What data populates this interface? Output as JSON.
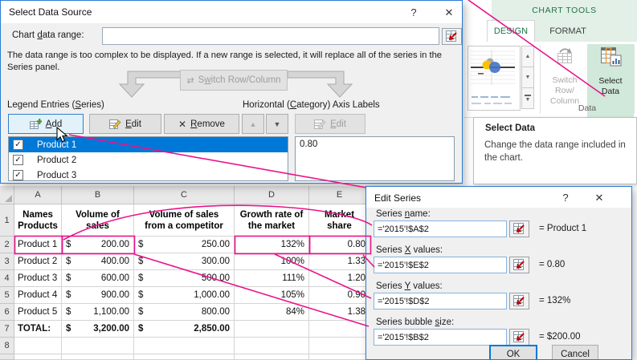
{
  "colors": {
    "excel_green": "#217346",
    "selection_blue": "#0078d7",
    "annotation_pink": "#e9138a",
    "contextual_tab_bg": "#e2f0e7",
    "active_button_bg": "#d0e9da"
  },
  "select_data_source": {
    "title": "Select Data Source",
    "help_icon": "?",
    "close_icon": "✕",
    "chart_data_range_label": {
      "text": "Chart data range:",
      "accel": 6
    },
    "chart_data_range_value": "",
    "warning_lines": [
      "The data range is too complex to be displayed. If a new range is selected, it will replace all of the series in the",
      "Series panel."
    ],
    "switch_row_column": {
      "text": "Switch Row/Column",
      "accel": 1
    },
    "legend_label": {
      "text": "Legend Entries (Series)",
      "accel": 16
    },
    "add_button": {
      "text": "Add",
      "accel": 0
    },
    "edit_button": {
      "text": "Edit",
      "accel": 0
    },
    "remove_button": {
      "text": "Remove",
      "accel": 0
    },
    "up_icon": "▲",
    "down_icon": "▼",
    "horizontal_label": {
      "text": "Horizontal (Category) Axis Labels",
      "accel": 12
    },
    "axis_edit_button": {
      "text": "Edit",
      "accel": 0
    },
    "series": [
      {
        "label": "Product 1",
        "checked": true,
        "selected": true
      },
      {
        "label": "Product 2",
        "checked": true,
        "selected": false
      },
      {
        "label": "Product 3",
        "checked": true,
        "selected": false
      }
    ],
    "axis_values": [
      "0.80"
    ]
  },
  "ribbon": {
    "contextual_label": "CHART TOOLS",
    "design_tab": "DESIGN",
    "format_tab": "FORMAT",
    "switch_label_line1": "Switch Row/",
    "switch_label_line2": "Column",
    "select_label_line1": "Select",
    "select_label_line2": "Data",
    "group_label": "Data",
    "scroll_up_icon": "▲",
    "scroll_down_icon": "▼",
    "scroll_more_icon": "▼"
  },
  "tooltip": {
    "title": "Select Data",
    "body_lines": [
      "Change the data range included in",
      "the chart."
    ]
  },
  "edit_series": {
    "title": "Edit Series",
    "help_icon": "?",
    "close_icon": "✕",
    "fields": [
      {
        "label": {
          "text": "Series name:",
          "accel": 7
        },
        "value": "='2015'!$A$2",
        "result": "= Product 1"
      },
      {
        "label": {
          "text": "Series X values:",
          "accel": 7
        },
        "value": "='2015'!$E$2",
        "result": "= 0.80"
      },
      {
        "label": {
          "text": "Series Y values:",
          "accel": 7
        },
        "value": "='2015'!$D$2",
        "result": "= 132%"
      },
      {
        "label": {
          "text": "Series bubble size:",
          "accel": 14
        },
        "value": "='2015'!$B$2",
        "result": "= $200.00"
      }
    ],
    "ok_label": "OK",
    "cancel_label": "Cancel"
  },
  "spreadsheet": {
    "currency_symbol": "$",
    "col_letters": [
      "A",
      "B",
      "C",
      "D",
      "E"
    ],
    "header_cells": [
      "Names\nProducts",
      "Volume of\nsales",
      "Volume of sales\nfrom a competitor",
      "Growth rate of\nthe market",
      "Market\nshare"
    ],
    "rows": [
      {
        "num": "2",
        "name": "Product 1",
        "sales": "200.00",
        "competitor": "250.00",
        "growth": "132%",
        "share": "0.80",
        "total": false
      },
      {
        "num": "3",
        "name": "Product 2",
        "sales": "400.00",
        "competitor": "300.00",
        "growth": "100%",
        "share": "1.33",
        "total": false
      },
      {
        "num": "4",
        "name": "Product 3",
        "sales": "600.00",
        "competitor": "500.00",
        "growth": "111%",
        "share": "1.20",
        "total": false
      },
      {
        "num": "5",
        "name": "Product 4",
        "sales": "900.00",
        "competitor": "1,000.00",
        "growth": "105%",
        "share": "0.90",
        "total": false
      },
      {
        "num": "6",
        "name": "Product 5",
        "sales": "1,100.00",
        "competitor": "800.00",
        "growth": "84%",
        "share": "1.38",
        "total": false
      },
      {
        "num": "7",
        "name": "TOTAL:",
        "sales": "3,200.00",
        "competitor": "2,850.00",
        "growth": "",
        "share": "",
        "total": true
      },
      {
        "num": "8",
        "name": "",
        "sales": "",
        "competitor": "",
        "growth": "",
        "share": "",
        "total": false
      },
      {
        "num": "",
        "name": "",
        "sales": "",
        "competitor": "",
        "growth": "",
        "share": "",
        "total": false,
        "partial": true
      }
    ]
  }
}
